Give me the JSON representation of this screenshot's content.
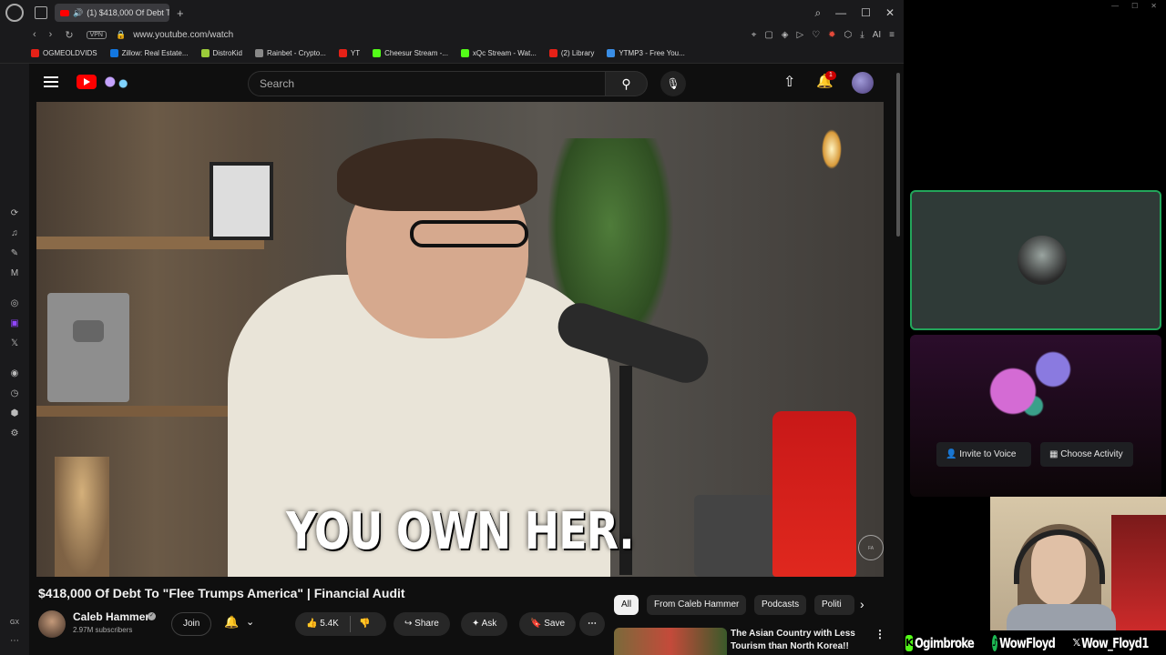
{
  "browser": {
    "tab_title": "(1) $418,000 Of Debt T",
    "url": "www.youtube.com/watch",
    "vpn_label": "VPN",
    "bookmarks": [
      {
        "label": "OGMEOLDVIDS",
        "color": "#e62117"
      },
      {
        "label": "Zillow: Real Estate...",
        "color": "#1277e1"
      },
      {
        "label": "DistroKid",
        "color": "#9ccc3a"
      },
      {
        "label": "Rainbet - Crypto...",
        "color": "#888888"
      },
      {
        "label": "YT",
        "color": "#e62117"
      },
      {
        "label": "Cheesur Stream -...",
        "color": "#53fc18"
      },
      {
        "label": "xQc Stream - Wat...",
        "color": "#53fc18"
      },
      {
        "label": "(2) Library",
        "color": "#e62117"
      },
      {
        "label": "YTMP3 - Free You...",
        "color": "#3a8ee6"
      }
    ]
  },
  "youtube": {
    "search_placeholder": "Search",
    "notification_count": "1",
    "caption": "YOU OWN HER.",
    "video_title": "$418,000 Of Debt To \"Flee Trumps America\" | Financial Audit",
    "channel_name": "Caleb Hammer",
    "subscribers": "2.97M subscribers",
    "join_label": "Join",
    "like_count": "5.4K",
    "share_label": "Share",
    "ask_label": "Ask",
    "save_label": "Save",
    "chips": [
      {
        "label": "All",
        "active": true
      },
      {
        "label": "From Caleb Hammer",
        "active": false
      },
      {
        "label": "Podcasts",
        "active": false
      },
      {
        "label": "Politi",
        "active": false
      }
    ],
    "recommended_title": "The Asian Country with Less Tourism than North Korea!!"
  },
  "discord": {
    "invite_label": "Invite to Voice",
    "choose_label": "Choose Activity"
  },
  "stream_overlay": {
    "kick_handle": "Ogimbroke",
    "spotify_handle": "WowFloyd",
    "x_handle": "Wow_Floyd1"
  }
}
